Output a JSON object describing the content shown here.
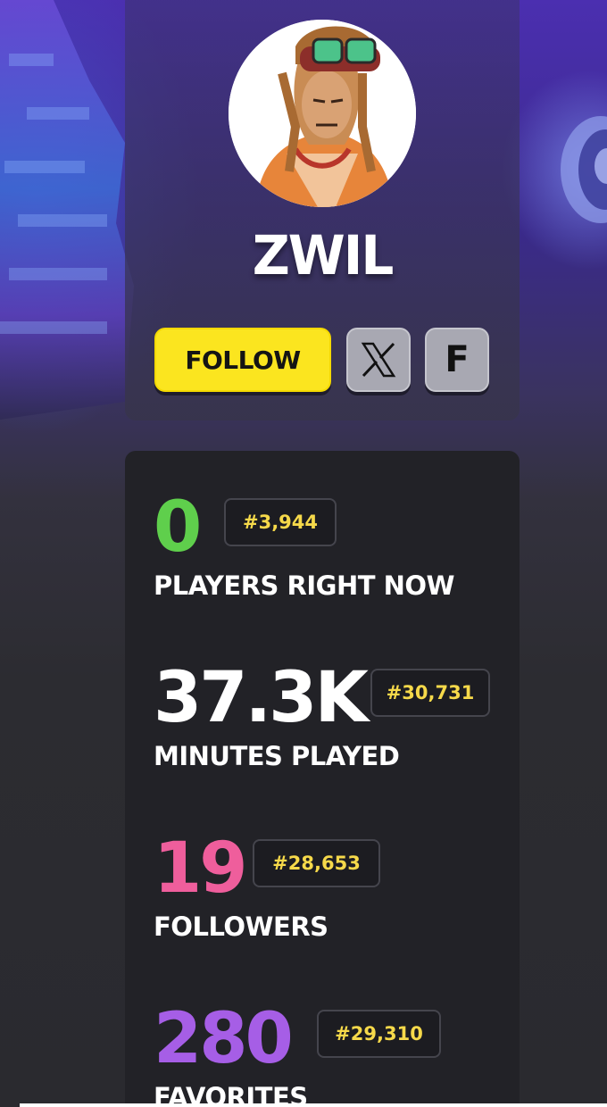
{
  "profile": {
    "name": "ZWIL",
    "follow_label": "FOLLOW",
    "x_label": "X",
    "f_label": "F"
  },
  "stats": [
    {
      "value": "0",
      "rank": "#3,944",
      "label": "PLAYERS RIGHT NOW"
    },
    {
      "value": "37.3K",
      "rank": "#30,731",
      "label": "MINUTES PLAYED"
    },
    {
      "value": "19",
      "rank": "#28,653",
      "label": "FOLLOWERS"
    },
    {
      "value": "280",
      "rank": "#29,310",
      "label": "FAVORITES"
    }
  ],
  "colors": {
    "follow_bg": "#fbe51f",
    "players_value": "#5fcf4c",
    "minutes_value": "#ffffff",
    "followers_value": "#ef5e9c",
    "favorites_value": "#a65ee6",
    "rank_text": "#f6d94a"
  },
  "icons": {
    "x": "x-logo-icon",
    "f": "fortnite-f-icon"
  }
}
